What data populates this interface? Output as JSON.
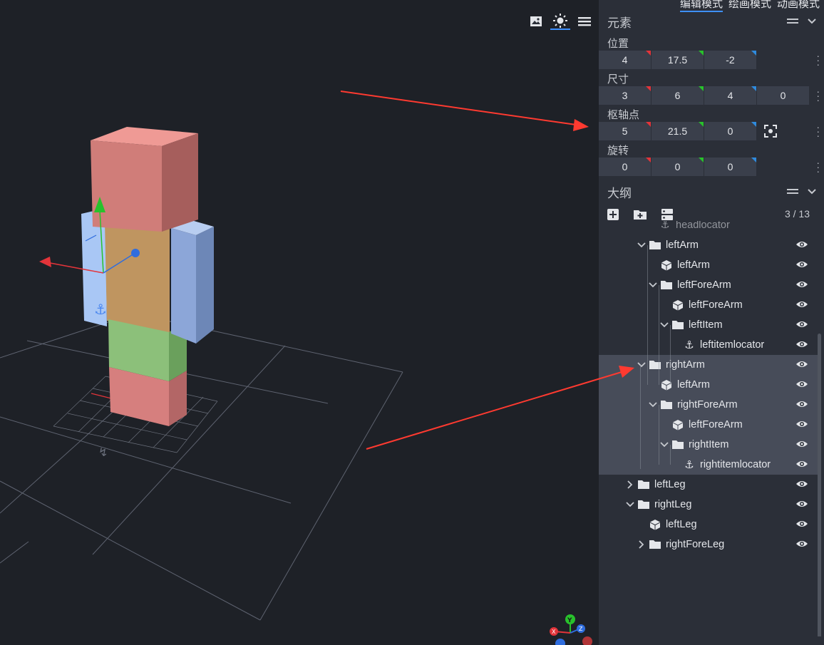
{
  "modes": {
    "items": [
      "编辑模式",
      "绘画模式",
      "动画模式"
    ],
    "selected": 0
  },
  "viewport_tools": [
    "image-icon",
    "sun-icon",
    "menu-icon"
  ],
  "element_panel": {
    "title": "元素",
    "position": {
      "label": "位置",
      "values": [
        "4",
        "17.5",
        "-2"
      ]
    },
    "size": {
      "label": "尺寸",
      "values": [
        "3",
        "6",
        "4",
        "0"
      ]
    },
    "pivot": {
      "label": "枢轴点",
      "values": [
        "5",
        "21.5",
        "0"
      ]
    },
    "rotation": {
      "label": "旋转",
      "values": [
        "0",
        "0",
        "0"
      ]
    }
  },
  "outliner": {
    "title": "大纲",
    "count": "3 / 13",
    "partial_top": "headlocator",
    "nodes": [
      {
        "label": "leftArm",
        "type": "folder",
        "expanded": true
      },
      {
        "label": "leftArm",
        "type": "cube"
      },
      {
        "label": "leftForeArm",
        "type": "folder",
        "expanded": true
      },
      {
        "label": "leftForeArm",
        "type": "cube"
      },
      {
        "label": "leftItem",
        "type": "folder",
        "expanded": true
      },
      {
        "label": "leftitemlocator",
        "type": "locator"
      },
      {
        "label": "rightArm",
        "type": "folder",
        "expanded": true,
        "selected": true
      },
      {
        "label": "leftArm",
        "type": "cube",
        "selected": true
      },
      {
        "label": "rightForeArm",
        "type": "folder",
        "expanded": true,
        "selected": true
      },
      {
        "label": "leftForeArm",
        "type": "cube",
        "selected": true
      },
      {
        "label": "rightItem",
        "type": "folder",
        "expanded": true,
        "selected": true
      },
      {
        "label": "rightitemlocator",
        "type": "locator",
        "selected": true
      },
      {
        "label": "leftLeg",
        "type": "folder",
        "expanded": false
      },
      {
        "label": "rightLeg",
        "type": "folder",
        "expanded": true
      },
      {
        "label": "leftLeg",
        "type": "cube"
      },
      {
        "label": "rightForeLeg",
        "type": "folder",
        "expanded": false
      }
    ]
  },
  "axis_gizmo": {
    "labels": [
      "Y",
      "Z",
      "X"
    ]
  },
  "colors": {
    "accent": "#3e90ff",
    "x_axis": "#e3343a",
    "y_axis": "#28c22c",
    "z_axis": "#2f6dde",
    "annotation_arrow": "#ff3a30"
  }
}
